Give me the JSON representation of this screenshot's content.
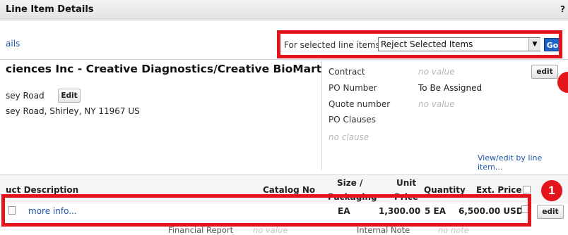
{
  "header": {
    "title": "Line Item Details",
    "help": "?"
  },
  "tabs_link": "ails",
  "selection": {
    "label": "For selected line items",
    "value": "Reject Selected Items",
    "arrow": "▼",
    "go_label": "Go"
  },
  "supplier": {
    "name": "ciences Inc - Creative Diagnostics/Creative BioMart",
    "address_line1": "sey Road",
    "edit_label": "Edit",
    "address_line2": "sey Road, Shirley, NY 11967 US"
  },
  "details": {
    "contract_label": "Contract",
    "contract_value": "no value",
    "po_number_label": "PO Number",
    "po_number_value": "To Be Assigned",
    "quote_label": "Quote number",
    "quote_value": "no value",
    "po_clauses_label": "PO Clauses",
    "no_clause": "no clause",
    "edit_label": "edit",
    "view_edit_link": "View/edit by line item..."
  },
  "table": {
    "columns": {
      "description": "uct Description",
      "catalog": "Catalog No",
      "size": "Size /",
      "size2": "Packaging",
      "unit": "Unit",
      "unit2": "Price",
      "quantity": "Quantity",
      "ext_price": "Ext. Price"
    },
    "row": {
      "more_info": "more info...",
      "size": "EA",
      "unit_price": "1,300.00",
      "quantity": "5 EA",
      "ext_price": "6,500.00 USD",
      "edit_label": "edit"
    },
    "below_row": {
      "financial_report_label": "Financial Report",
      "financial_report_value": "no value",
      "internal_note_label": "Internal Note",
      "internal_note_value": "no note"
    }
  },
  "annotation": {
    "badge": "1"
  },
  "colors": {
    "highlight": "#e3141c",
    "link": "#1b56a6",
    "go_button": "#1d63c6"
  }
}
